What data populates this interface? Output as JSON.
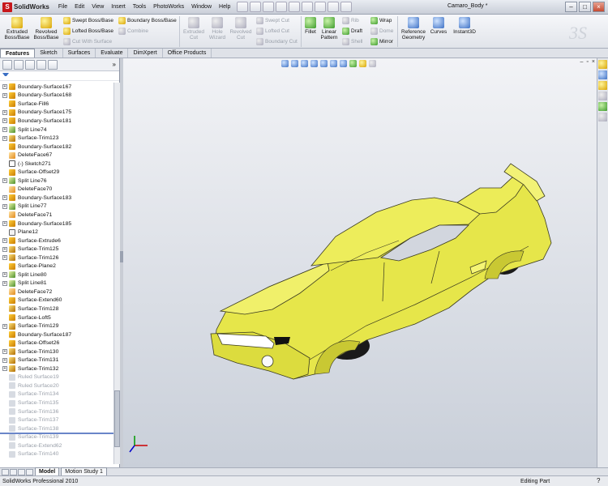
{
  "app": {
    "name": "SolidWorks",
    "doc_title": "Camaro_Body *"
  },
  "menu": [
    "File",
    "Edit",
    "View",
    "Insert",
    "Tools",
    "PhotoWorks",
    "Window",
    "Help"
  ],
  "window_controls": {
    "min": "–",
    "max": "□",
    "close": "×"
  },
  "ribbon": {
    "extruded_boss": [
      "Extruded",
      "Boss/Base"
    ],
    "revolved_boss": [
      "Revolved",
      "Boss/Base"
    ],
    "swept_boss": "Swept Boss/Base",
    "lofted_boss": "Lofted Boss/Base",
    "boundary_boss": "Boundary Boss/Base",
    "combine": "Combine",
    "cut_with_surface": "Cut With Surface",
    "extruded_cut": [
      "Extruded",
      "Cut"
    ],
    "hole_wizard": [
      "Hole",
      "Wizard"
    ],
    "revolved_cut": [
      "Revolved",
      "Cut"
    ],
    "swept_cut": "Swept Cut",
    "lofted_cut": "Lofted Cut",
    "boundary_cut": "Boundary Cut",
    "fillet": "Fillet",
    "linear_pattern": [
      "Linear",
      "Pattern"
    ],
    "rib": "Rib",
    "draft": "Draft",
    "shell": "Shell",
    "wrap": "Wrap",
    "dome": "Dome",
    "mirror": "Mirror",
    "reference_geometry": [
      "Reference",
      "Geometry"
    ],
    "curves": "Curves",
    "instant3d": "Instant3D"
  },
  "tabs": [
    "Features",
    "Sketch",
    "Surfaces",
    "Evaluate",
    "DimXpert",
    "Office Products"
  ],
  "tree": {
    "items": [
      {
        "label": "Boundary-Surface167",
        "type": "surf",
        "exp": true
      },
      {
        "label": "Boundary-Surface168",
        "type": "surf",
        "exp": true
      },
      {
        "label": "Surface-Fill6",
        "type": "surf",
        "exp": false
      },
      {
        "label": "Boundary-Surface175",
        "type": "surf",
        "exp": true
      },
      {
        "label": "Boundary-Surface181",
        "type": "surf",
        "exp": true
      },
      {
        "label": "Split Line74",
        "type": "split",
        "exp": true
      },
      {
        "label": "Surface-Trim123",
        "type": "trim",
        "exp": true
      },
      {
        "label": "Boundary-Surface182",
        "type": "surf",
        "exp": false
      },
      {
        "label": "DeleteFace67",
        "type": "del",
        "exp": false
      },
      {
        "label": "(-) Sketch271",
        "type": "sk",
        "exp": false
      },
      {
        "label": "Surface-Offset29",
        "type": "surf",
        "exp": false
      },
      {
        "label": "Split Line76",
        "type": "split",
        "exp": true
      },
      {
        "label": "DeleteFace70",
        "type": "del",
        "exp": false
      },
      {
        "label": "Boundary-Surface183",
        "type": "surf",
        "exp": true
      },
      {
        "label": "Split Line77",
        "type": "split",
        "exp": true
      },
      {
        "label": "DeleteFace71",
        "type": "del",
        "exp": false
      },
      {
        "label": "Boundary-Surface185",
        "type": "surf",
        "exp": true
      },
      {
        "label": "Plane12",
        "type": "plane",
        "exp": false
      },
      {
        "label": "Surface-Extrude6",
        "type": "surf",
        "exp": true
      },
      {
        "label": "Surface-Trim125",
        "type": "trim",
        "exp": true
      },
      {
        "label": "Surface-Trim126",
        "type": "trim",
        "exp": true
      },
      {
        "label": "Surface-Plane2",
        "type": "surf",
        "exp": false
      },
      {
        "label": "Split Line80",
        "type": "split",
        "exp": true
      },
      {
        "label": "Split Line81",
        "type": "split",
        "exp": true
      },
      {
        "label": "DeleteFace72",
        "type": "del",
        "exp": false
      },
      {
        "label": "Surface-Extend60",
        "type": "surf",
        "exp": false
      },
      {
        "label": "Surface-Trim128",
        "type": "trim",
        "exp": false
      },
      {
        "label": "Surface-Loft5",
        "type": "surf",
        "exp": false
      },
      {
        "label": "Surface-Trim129",
        "type": "trim",
        "exp": true
      },
      {
        "label": "Boundary-Surface187",
        "type": "surf",
        "exp": false
      },
      {
        "label": "Surface-Offset26",
        "type": "surf",
        "exp": false
      },
      {
        "label": "Surface-Trim130",
        "type": "trim",
        "exp": true
      },
      {
        "label": "Surface-Trim131",
        "type": "trim",
        "exp": true
      },
      {
        "label": "Surface-Trim132",
        "type": "trim",
        "exp": true
      },
      {
        "label": "Ruled Surface19",
        "type": "sup",
        "exp": false
      },
      {
        "label": "Ruled Surface20",
        "type": "sup",
        "exp": false
      },
      {
        "label": "Surface-Trim134",
        "type": "sup",
        "exp": false
      },
      {
        "label": "Surface-Trim135",
        "type": "sup",
        "exp": false
      },
      {
        "label": "Surface-Trim136",
        "type": "sup",
        "exp": false
      },
      {
        "label": "Surface-Trim137",
        "type": "sup",
        "exp": false
      },
      {
        "label": "Surface-Trim138",
        "type": "sup",
        "exp": false
      },
      {
        "label": "Surface-Trim139",
        "type": "sup",
        "exp": false
      },
      {
        "label": "Surface-Extend62",
        "type": "sup",
        "exp": false
      },
      {
        "label": "Surface-Trim140",
        "type": "sup",
        "exp": false
      }
    ]
  },
  "bottom_tabs": [
    "Model",
    "Motion Study 1"
  ],
  "status": {
    "left": "SolidWorks Professional 2010",
    "right": "Editing Part",
    "help": "?"
  },
  "colors": {
    "body": "#e8e84a",
    "body_shadow": "#b8b524",
    "tire": "#1a1a1a"
  }
}
